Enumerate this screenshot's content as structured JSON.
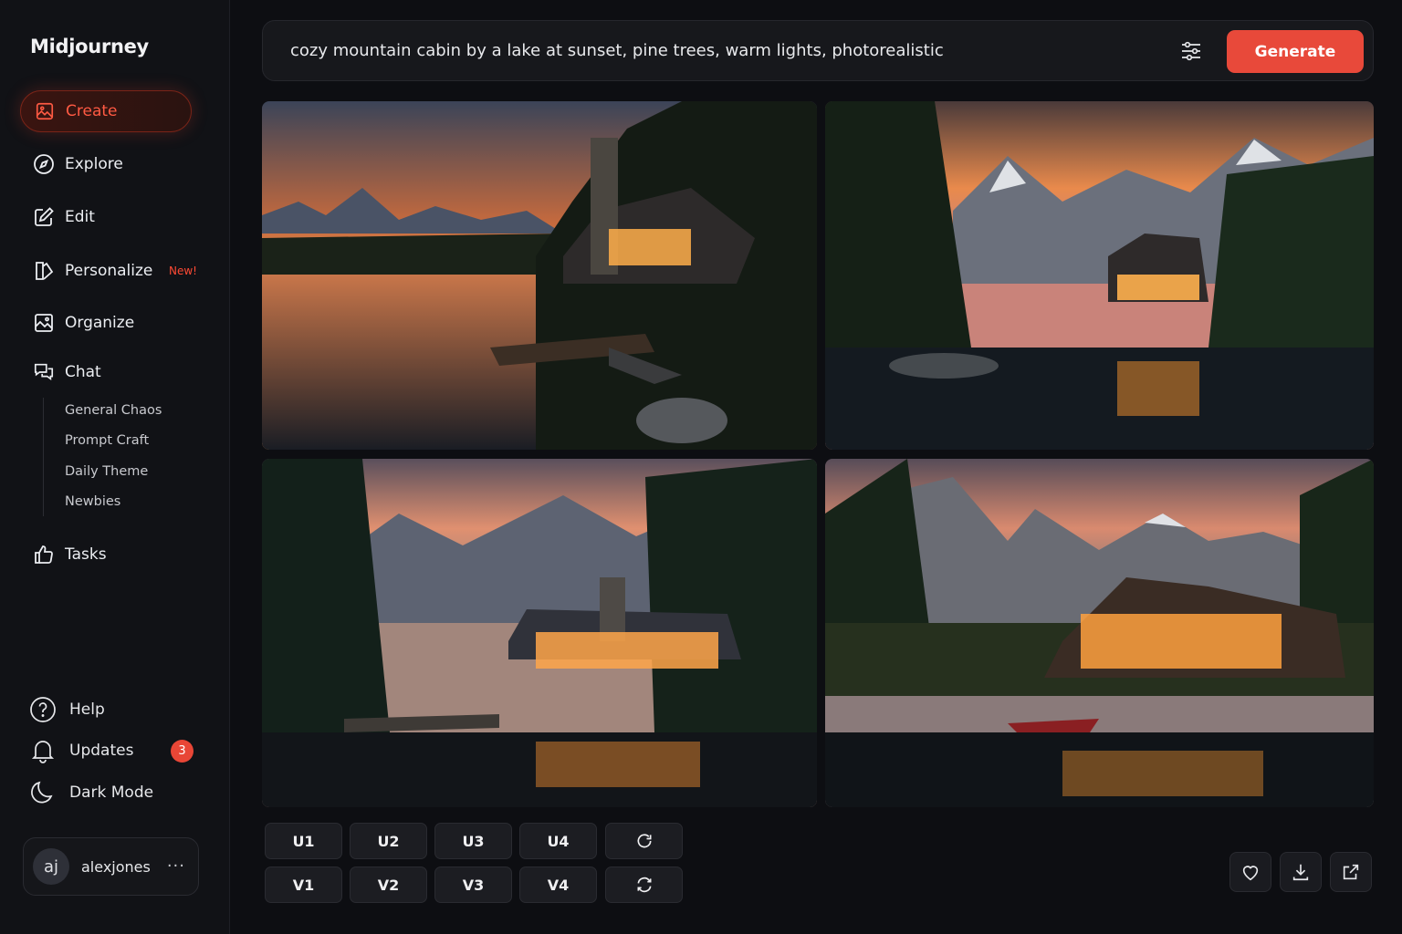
{
  "app": {
    "name": "Midjourney"
  },
  "colors": {
    "accent": "#e8493a",
    "active_text": "#ff5a43",
    "background": "#0d0e12",
    "sidebar": "#111216"
  },
  "nav": {
    "create": {
      "label": "Create",
      "icon": "image-icon"
    },
    "explore": {
      "label": "Explore",
      "icon": "compass-icon"
    },
    "edit": {
      "label": "Edit",
      "icon": "edit-icon"
    },
    "personalize": {
      "label": "Personalize",
      "icon": "personalize-icon",
      "badge": "New!"
    },
    "organize": {
      "label": "Organize",
      "icon": "gallery-icon"
    },
    "chat": {
      "label": "Chat",
      "icon": "chat-icon",
      "channels": [
        "General Chaos",
        "Prompt Craft",
        "Daily Theme",
        "Newbies"
      ]
    },
    "tasks": {
      "label": "Tasks",
      "icon": "thumbs-up-icon"
    }
  },
  "footer": {
    "help": {
      "label": "Help",
      "icon": "help-icon"
    },
    "updates": {
      "label": "Updates",
      "icon": "bell-icon",
      "count": "3"
    },
    "dark_mode": {
      "label": "Dark Mode",
      "icon": "moon-icon"
    },
    "user": {
      "initials": "aj",
      "name": "alexjones",
      "menu": "···"
    }
  },
  "prompt": {
    "text": "cozy mountain cabin by a lake at sunset, pine trees, warm lights, photorealistic",
    "generate_label": "Generate"
  },
  "actions": {
    "upscale": [
      "U1",
      "U2",
      "U3",
      "U4"
    ],
    "variation": [
      "V1",
      "V2",
      "V3",
      "V4"
    ],
    "reroll_icon": "refresh-icon",
    "remix_icon": "cycle-icon",
    "tools": [
      "heart-icon",
      "download-icon",
      "external-link-icon"
    ]
  }
}
